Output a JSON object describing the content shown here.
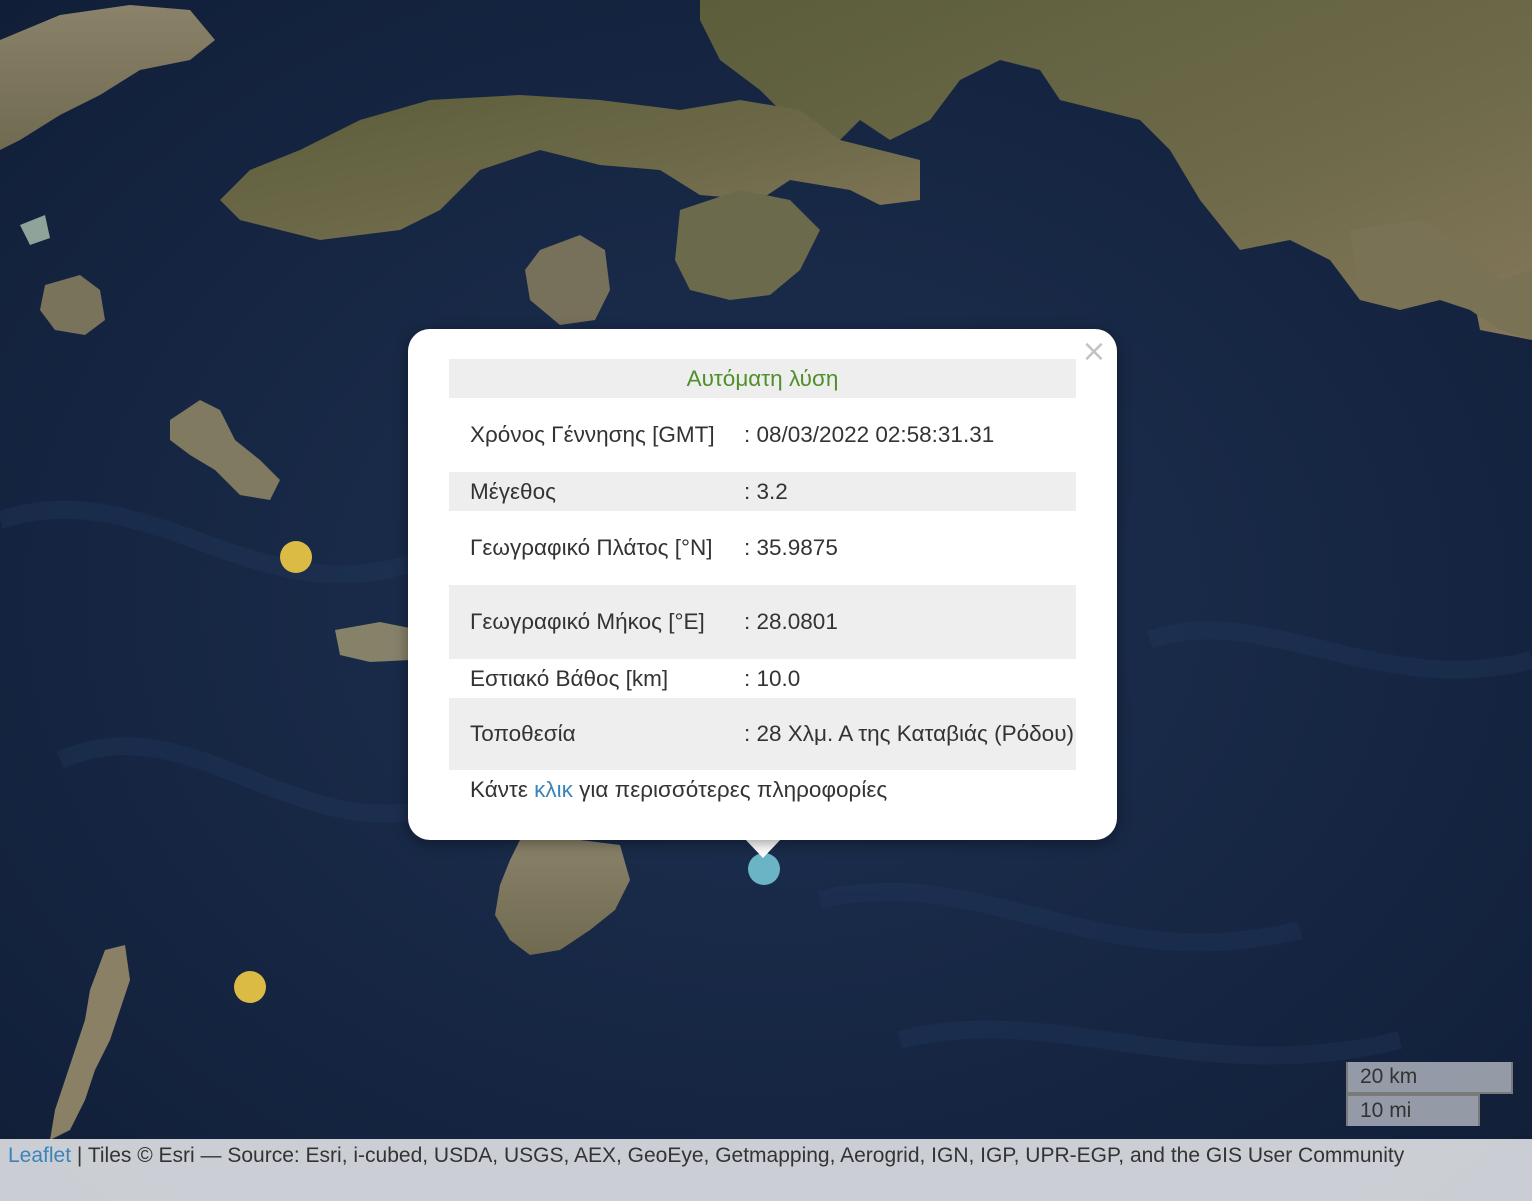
{
  "map": {
    "basemap": "satellite",
    "markers": [
      {
        "name": "earthquake-marker-yellow-1",
        "color": "#dcbb45"
      },
      {
        "name": "earthquake-marker-yellow-2",
        "color": "#dcbb45"
      },
      {
        "name": "earthquake-marker-selected",
        "color": "#6ab4c6"
      }
    ]
  },
  "popup": {
    "header": "Αυτόματη λύση",
    "close_icon": "×",
    "rows": {
      "time_label": "Χρόνος Γέννησης [GMT]",
      "time_value": ": 08/03/2022 02:58:31.31",
      "magnitude_label": "Μέγεθος",
      "magnitude_value": ": 3.2",
      "lat_label": "Γεωγραφικό Πλάτος [°N]",
      "lat_value": ": 35.9875",
      "lon_label": "Γεωγραφικό Μήκος [°E]",
      "lon_value": ": 28.0801",
      "depth_label": "Εστιακό Βάθος [km]",
      "depth_value": ": 10.0",
      "location_label": "Τοποθεσία",
      "location_value": ": 28 Χλμ. Α της Καταβιάς (Ρόδου)"
    },
    "more_prefix": "Κάντε ",
    "more_link": "κλικ",
    "more_suffix": " για περισσότερες πληροφορίες"
  },
  "scale": {
    "km": "20 km",
    "mi": "10 mi"
  },
  "attribution": {
    "leaflet": "Leaflet",
    "separator": " | ",
    "tiles": "Tiles © Esri — Source: Esri, i-cubed, USDA, USGS, AEX, GeoEye, Getmapping, Aerogrid, IGN, IGP, UPR-EGP, and the GIS User Community"
  }
}
